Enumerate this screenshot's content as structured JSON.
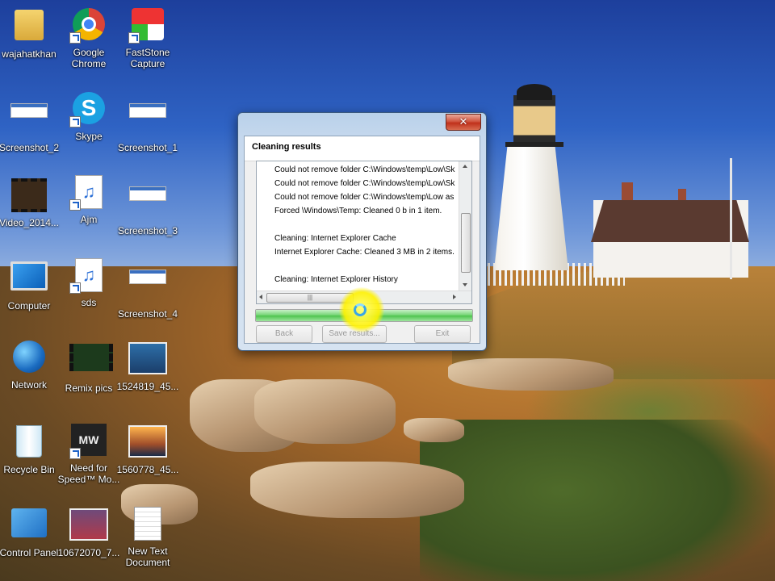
{
  "desktop": {
    "icons": [
      {
        "label": "wajahatkhan",
        "icon": "user-folder-icon"
      },
      {
        "label": "Google Chrome",
        "icon": "chrome-icon"
      },
      {
        "label": "FastStone Capture",
        "icon": "faststone-capture-icon"
      },
      {
        "label": "Screenshot_2",
        "icon": "image-thumbnail-icon"
      },
      {
        "label": "Skype",
        "icon": "skype-icon"
      },
      {
        "label": "Screenshot_1",
        "icon": "image-thumbnail-icon"
      },
      {
        "label": "Video_2014...",
        "icon": "video-file-icon"
      },
      {
        "label": "Ajm",
        "icon": "audio-file-icon"
      },
      {
        "label": "Screenshot_3",
        "icon": "image-thumbnail-icon"
      },
      {
        "label": "Computer",
        "icon": "computer-icon"
      },
      {
        "label": "sds",
        "icon": "audio-file-icon"
      },
      {
        "label": "Screenshot_4",
        "icon": "image-thumbnail-icon"
      },
      {
        "label": "Network",
        "icon": "network-icon"
      },
      {
        "label": "Remix pics",
        "icon": "video-file-icon"
      },
      {
        "label": "1524819_45...",
        "icon": "photo-thumbnail-icon"
      },
      {
        "label": "Recycle Bin",
        "icon": "recycle-bin-icon"
      },
      {
        "label": "Need for Speed™ Mo...",
        "icon": "game-shortcut-icon"
      },
      {
        "label": "1560778_45...",
        "icon": "photo-thumbnail-icon"
      },
      {
        "label": "Control Panel",
        "icon": "control-panel-icon"
      },
      {
        "label": "10672070_7...",
        "icon": "photo-thumbnail-icon"
      },
      {
        "label": "New Text Document",
        "icon": "text-document-icon"
      }
    ]
  },
  "dialog": {
    "title": "Cleaning results",
    "close_label": "✕",
    "results": [
      "Could not remove folder C:\\Windows\\temp\\Low\\Sk",
      "Could not remove folder C:\\Windows\\temp\\Low\\Sk",
      "Could not remove folder C:\\Windows\\temp\\Low as",
      "Forced \\Windows\\Temp: Cleaned 0 b in 1 item.",
      "",
      "Cleaning: Internet Explorer Cache",
      "Internet Explorer Cache: Cleaned 3 MB in 2 items.",
      "",
      "Cleaning: Internet Explorer History"
    ],
    "progress_fraction": 1.0,
    "buttons": {
      "back": "Back",
      "save": "Save results...",
      "exit": "Exit"
    }
  },
  "colors": {
    "progress_green": "#4cc24c",
    "close_red": "#c0311b",
    "cursor_highlight": "#fff200"
  }
}
